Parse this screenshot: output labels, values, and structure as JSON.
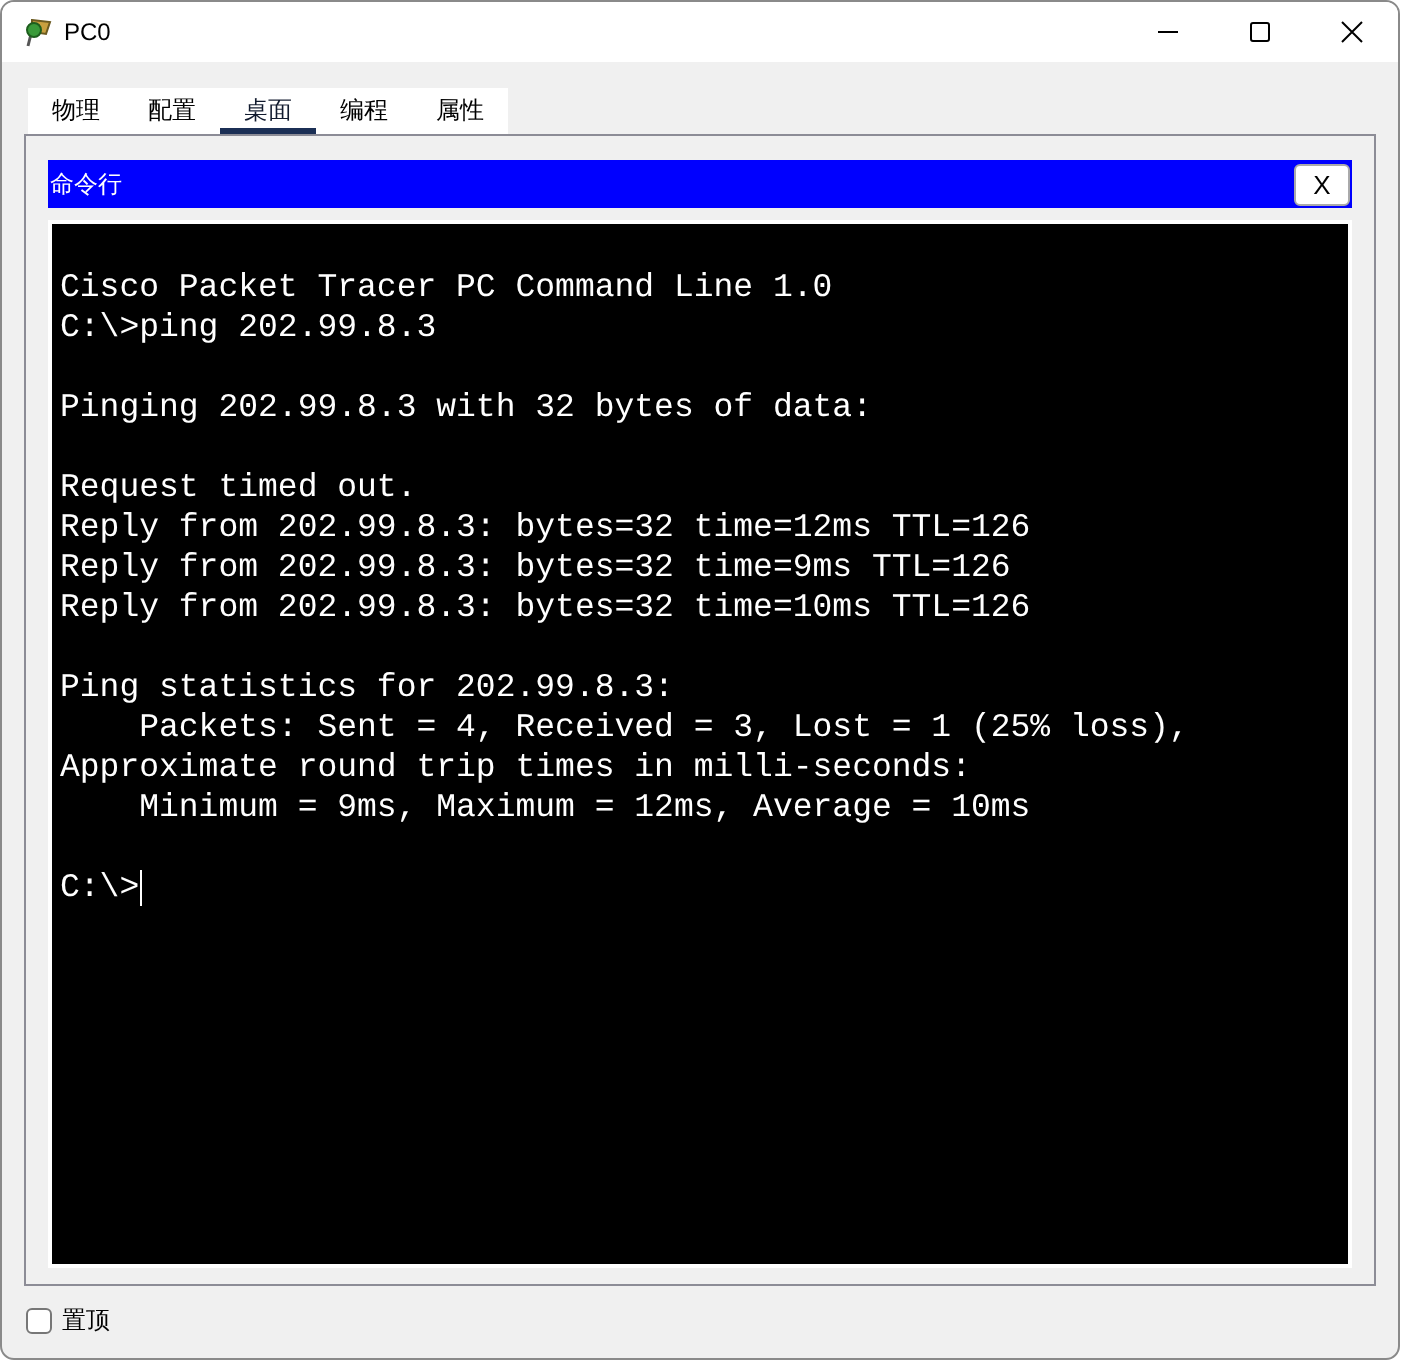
{
  "window": {
    "title": "PC0"
  },
  "tabs": [
    {
      "label": "物理",
      "selected": false
    },
    {
      "label": "配置",
      "selected": false
    },
    {
      "label": "桌面",
      "selected": true
    },
    {
      "label": "编程",
      "selected": false
    },
    {
      "label": "属性",
      "selected": false
    }
  ],
  "panel": {
    "title": "命令行",
    "close_label": "X"
  },
  "terminal": {
    "paragraphs": [
      [
        "Cisco Packet Tracer PC Command Line 1.0",
        "C:\\>ping 202.99.8.3"
      ],
      [
        "Pinging 202.99.8.3 with 32 bytes of data:"
      ],
      [
        "Request timed out.",
        "Reply from 202.99.8.3: bytes=32 time=12ms TTL=126",
        "Reply from 202.99.8.3: bytes=32 time=9ms TTL=126",
        "Reply from 202.99.8.3: bytes=32 time=10ms TTL=126"
      ],
      [
        "Ping statistics for 202.99.8.3:",
        "    Packets: Sent = 4, Received = 3, Lost = 1 (25% loss),",
        "Approximate round trip times in milli-seconds:",
        "    Minimum = 9ms, Maximum = 12ms, Average = 10ms"
      ],
      [
        "C:\\>"
      ]
    ]
  },
  "always_on_top": {
    "label": "置顶",
    "checked": false
  }
}
